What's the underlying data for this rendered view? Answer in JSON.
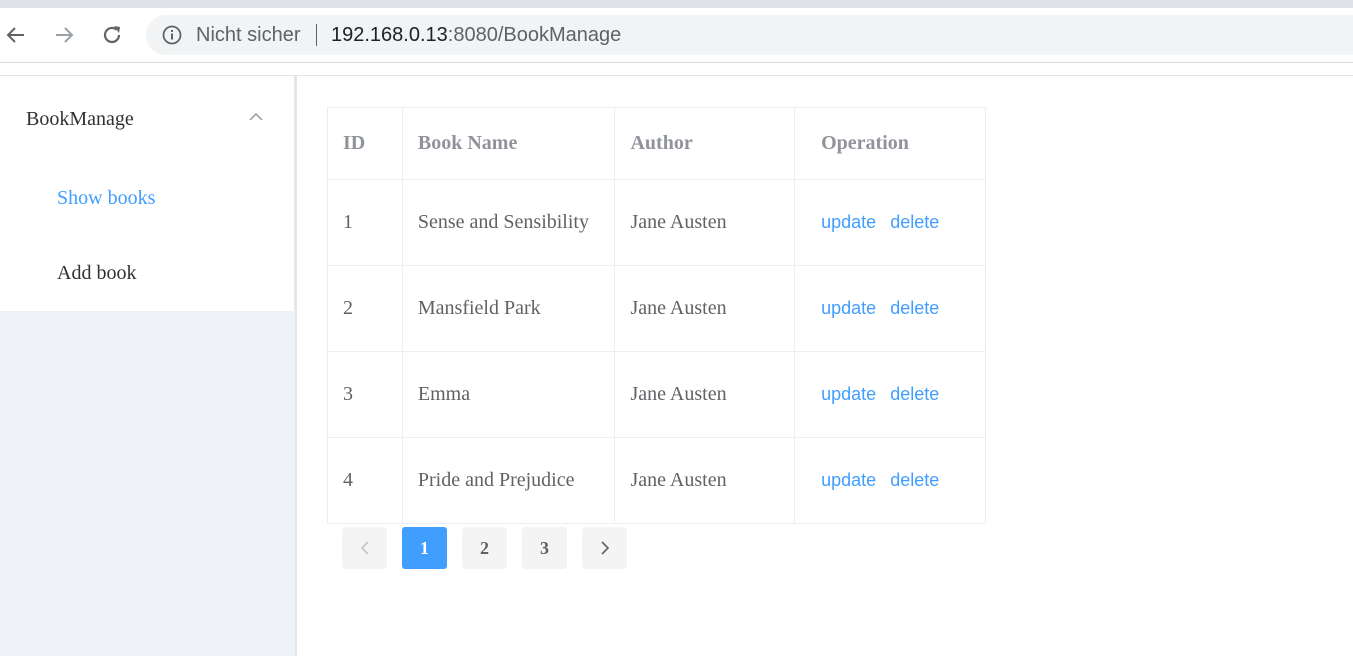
{
  "browser": {
    "security_label": "Nicht sicher",
    "url_host": "192.168.0.13",
    "url_rest": ":8080/BookManage"
  },
  "sidebar": {
    "group_title": "BookManage",
    "items": [
      {
        "label": "Show books",
        "active": true
      },
      {
        "label": "Add book",
        "active": false
      }
    ]
  },
  "table": {
    "headers": [
      "ID",
      "Book Name",
      "Author",
      "Operation"
    ],
    "rows": [
      {
        "id": "1",
        "name": "Sense and Sensibility",
        "author": "Jane Austen",
        "update": "update",
        "delete": "delete"
      },
      {
        "id": "2",
        "name": "Mansfield Park",
        "author": "Jane Austen",
        "update": "update",
        "delete": "delete"
      },
      {
        "id": "3",
        "name": "Emma",
        "author": "Jane Austen",
        "update": "update",
        "delete": "delete"
      },
      {
        "id": "4",
        "name": "Pride and Prejudice",
        "author": "Jane Austen",
        "update": "update",
        "delete": "delete"
      }
    ]
  },
  "pagination": {
    "pages": [
      "1",
      "2",
      "3"
    ],
    "current": "1"
  },
  "colors": {
    "accent": "#409eff",
    "header_text": "#909399",
    "body_text": "#606266",
    "sidebar_bg": "#eef1f6"
  }
}
